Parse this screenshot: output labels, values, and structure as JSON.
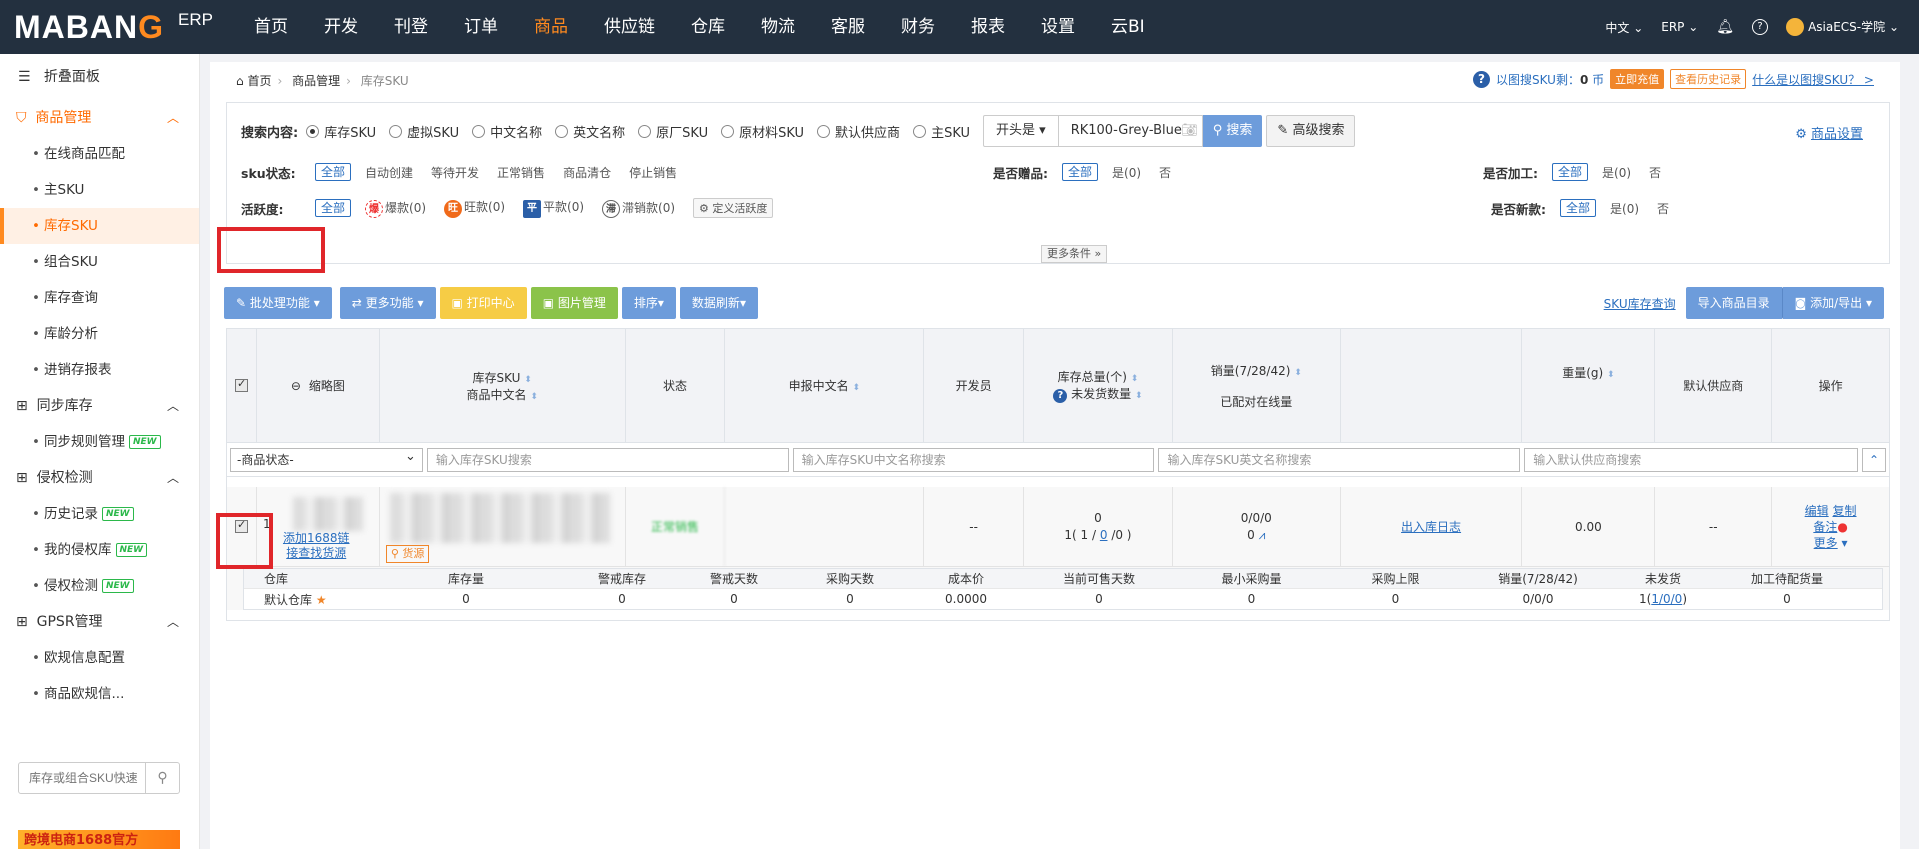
{
  "header": {
    "logo_text": "MABANG",
    "logo_suffix": "ERP",
    "nav": [
      "首页",
      "开发",
      "刊登",
      "订单",
      "商品",
      "供应链",
      "仓库",
      "物流",
      "客服",
      "财务",
      "报表",
      "设置",
      "云BI"
    ],
    "active_nav": "商品",
    "lang": "中文",
    "product": "ERP",
    "user": "AsiaECS-学院"
  },
  "sidebar": {
    "fold": "折叠面板",
    "groups": [
      {
        "label": "商品管理",
        "items": [
          "在线商品匹配",
          "主SKU",
          "库存SKU",
          "组合SKU",
          "库存查询",
          "库龄分析",
          "进销存报表"
        ]
      },
      {
        "label": "同步库存",
        "items": [
          "同步规则管理"
        ]
      },
      {
        "label": "侵权检测",
        "items": [
          "历史记录",
          "我的侵权库",
          "侵权检测"
        ]
      },
      {
        "label": "GPSR管理",
        "items": [
          "欧规信息配置",
          "商品欧规信..."
        ]
      }
    ],
    "active_item": "库存SKU",
    "new_badge": "NEW",
    "search_placeholder": "库存或组合SKU快速",
    "banner": "跨境电商1688官方"
  },
  "breadcrumb": {
    "home": "首页",
    "level1": "商品管理",
    "current": "库存SKU"
  },
  "topinfo": {
    "text": "以图搜SKU剩：",
    "count": "0",
    "unit": "币",
    "recharge": "立即充值",
    "history": "查看历史记录",
    "help": "什么是以图搜SKU？ >"
  },
  "filter": {
    "search_label": "搜索内容:",
    "search_types": [
      "库存SKU",
      "虚拟SKU",
      "中文名称",
      "英文名称",
      "原厂SKU",
      "原材料SKU",
      "默认供应商",
      "主SKU"
    ],
    "selected_type": "库存SKU",
    "match_mode": "开头是",
    "search_value": "RK100-Grey-Blue",
    "search_btn": "搜索",
    "adv_btn": "高级搜索",
    "settings": "商品设置",
    "sku_status_label": "sku状态:",
    "all": "全部",
    "sku_status": [
      "自动创建",
      "等待开发",
      "正常销售",
      "商品清仓",
      "停止销售"
    ],
    "gift_label": "是否赠品:",
    "gift_opts": [
      "是(0)",
      "否"
    ],
    "process_label": "是否加工:",
    "process_opts": [
      "是(0)",
      "否"
    ],
    "activity_label": "活跃度:",
    "activity": [
      {
        "icon": "爆",
        "label": "爆款(0)"
      },
      {
        "icon": "旺",
        "label": "旺款(0)"
      },
      {
        "icon": "平",
        "label": "平款(0)"
      },
      {
        "icon": "滞",
        "label": "滞销款(0)"
      }
    ],
    "define_activity": "定义活跃度",
    "new_label": "是否新款:",
    "new_opts": [
      "是(0)",
      "否"
    ],
    "more_cond": "更多条件"
  },
  "toolbar": {
    "batch": "批处理功能",
    "more": "更多功能",
    "print": "打印中心",
    "image": "图片管理",
    "sort": "排序",
    "refresh": "数据刷新",
    "sku_query": "SKU库存查询",
    "import_catalog": "导入商品目录",
    "add_export": "添加/导出"
  },
  "table": {
    "headers": {
      "thumb": "缩略图",
      "sku": "库存SKU",
      "cn_name": "商品中文名",
      "status": "状态",
      "declare": "申报中文名",
      "developer": "开发员",
      "stock_total": "库存总量(个)",
      "unshipped": "未发货数量",
      "sales": "销量(7/28/42)",
      "online": "已配对在线量",
      "weight": "重量(g)",
      "supplier": "默认供应商",
      "ops": "操作"
    },
    "filters": {
      "status_select": "-商品状态-",
      "sku_ph": "输入库存SKU搜索",
      "cn_ph": "输入库存SKU中文名称搜索",
      "en_ph": "输入库存SKU英文名称搜索",
      "supplier_ph": "输入默认供应商搜索"
    },
    "row": {
      "index": "1",
      "add1688": "添加1688链",
      "find_source": "接查找货源",
      "source_badge": "货源",
      "status": "正常销售",
      "developer": "--",
      "stock": "0",
      "stock_detail_prefix": "1( 1 / ",
      "stock_detail_link": "0",
      "stock_detail_suffix": " /0 )",
      "sales": "0/0/0",
      "online": "0",
      "log": "出入库日志",
      "weight": "0.00",
      "supplier": "--",
      "edit": "编辑",
      "copy": "复制",
      "note": "备注",
      "more": "更多"
    },
    "sub_headers": [
      "仓库",
      "库存量",
      "警戒库存",
      "警戒天数",
      "采购天数",
      "成本价",
      "当前可售天数",
      "最小采购量",
      "采购上限",
      "销量(7/28/42)",
      "未发货",
      "加工待配货量"
    ],
    "sub_row": {
      "warehouse": "默认仓库",
      "values": [
        "0",
        "0",
        "0",
        "0",
        "0.0000",
        "0",
        "0",
        "0",
        "0/0/0"
      ],
      "unshipped_prefix": "1(",
      "unshipped_link": "1/0/0",
      "unshipped_suffix": ")",
      "process": "0"
    }
  }
}
